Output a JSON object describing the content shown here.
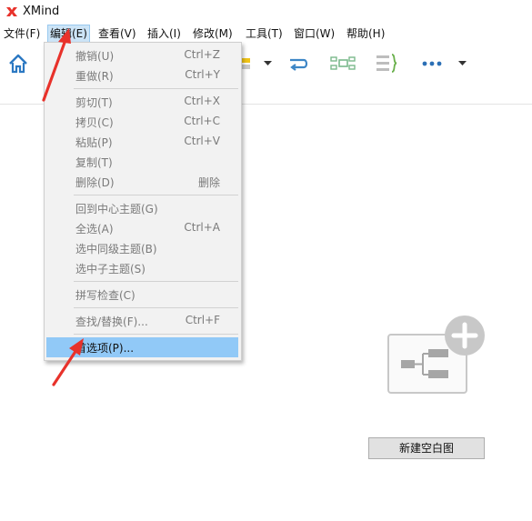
{
  "titlebar": {
    "title": "XMind",
    "logo": "xmind-logo-icon"
  },
  "menubar": [
    {
      "label": "文件(F)"
    },
    {
      "label": "编辑(E)",
      "active": true
    },
    {
      "label": "查看(V)"
    },
    {
      "label": "插入(I)"
    },
    {
      "label": "修改(M)"
    },
    {
      "label": "工具(T)"
    },
    {
      "label": "窗口(W)"
    },
    {
      "label": "帮助(H)"
    }
  ],
  "toolbar": {
    "icons": [
      "home-icon",
      "topic-style-icon",
      "dropdown-arrow-icon",
      "relationship-icon",
      "summary-map-icon",
      "boundary-icon",
      "more-icon",
      "dropdown-arrow-icon"
    ]
  },
  "edit_menu": {
    "items": [
      {
        "label": "撤销(U)",
        "shortcut": "Ctrl+Z",
        "enabled": false
      },
      {
        "label": "重做(R)",
        "shortcut": "Ctrl+Y",
        "enabled": false
      },
      {
        "label": "剪切(T)",
        "shortcut": "Ctrl+X",
        "enabled": false
      },
      {
        "label": "拷贝(C)",
        "shortcut": "Ctrl+C",
        "enabled": false
      },
      {
        "label": "粘贴(P)",
        "shortcut": "Ctrl+V",
        "enabled": false
      },
      {
        "label": "复制(T)",
        "shortcut": "",
        "enabled": false
      },
      {
        "label": "删除(D)",
        "shortcut": "删除",
        "enabled": false
      },
      {
        "label": "回到中心主题(G)",
        "shortcut": "",
        "enabled": false
      },
      {
        "label": "全选(A)",
        "shortcut": "Ctrl+A",
        "enabled": false
      },
      {
        "label": "选中同级主题(B)",
        "shortcut": "",
        "enabled": false
      },
      {
        "label": "选中子主题(S)",
        "shortcut": "",
        "enabled": false
      },
      {
        "label": "拼写检查(C)",
        "shortcut": "",
        "enabled": false
      },
      {
        "label": "查找/替换(F)...",
        "shortcut": "Ctrl+F",
        "enabled": false
      },
      {
        "label": "首选项(P)...",
        "shortcut": "",
        "enabled": true,
        "highlighted": true
      }
    ]
  },
  "empty_state": {
    "icon": "new-mind-map-plus-icon",
    "button_label": "新建空白图"
  },
  "annotations": {
    "color": "#e8322b"
  }
}
